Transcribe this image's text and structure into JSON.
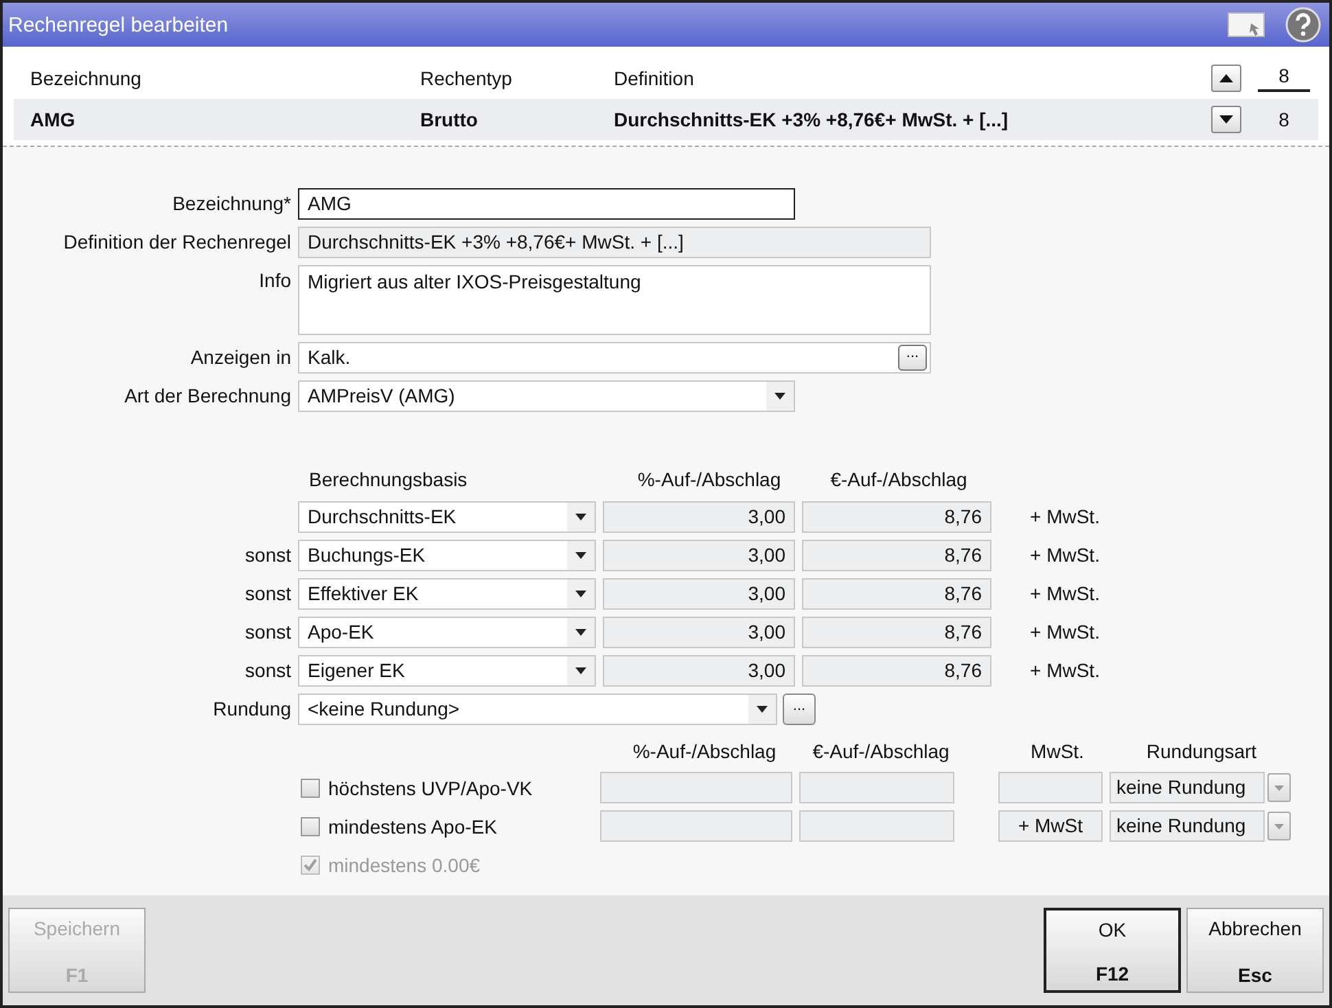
{
  "window": {
    "title": "Rechenregel bearbeiten"
  },
  "table": {
    "columns": [
      "Bezeichnung",
      "Rechentyp",
      "Definition"
    ],
    "rows": [
      {
        "cells": [
          "AMG",
          "Brutto",
          "Durchschnitts-EK +3% +8,76€+ MwSt. + [...]"
        ],
        "selected": true
      }
    ],
    "counts": [
      "8",
      "8"
    ]
  },
  "form": {
    "fields": [
      {
        "label": "Bezeichnung*",
        "value": "AMG",
        "kind": "text"
      },
      {
        "label": "Definition der Rechenregel",
        "value": "Durchschnitts-EK +3% +8,76€+ MwSt. + [...]",
        "kind": "readonly"
      },
      {
        "label": "Info",
        "value": "Migriert aus alter IXOS-Preisgestaltung",
        "kind": "textarea"
      },
      {
        "label": "Anzeigen in",
        "value": "Kalk.",
        "kind": "picker",
        "button": "..."
      },
      {
        "label": "Art der Berechnung",
        "value": "AMPreisV (AMG)",
        "kind": "select"
      }
    ]
  },
  "calc": {
    "headers": [
      "Berechnungsbasis",
      "%-Auf-/Abschlag",
      "€-Auf-/Abschlag"
    ],
    "rows": [
      {
        "basis": "Durchschnitts-EK",
        "percent": "3,00",
        "euro": "8,76",
        "suffix": "+ MwSt."
      },
      {
        "prefix": "sonst",
        "basis": "Buchungs-EK",
        "percent": "3,00",
        "euro": "8,76",
        "suffix": "+ MwSt."
      },
      {
        "prefix": "sonst",
        "basis": "Effektiver EK",
        "percent": "3,00",
        "euro": "8,76",
        "suffix": "+ MwSt."
      },
      {
        "prefix": "sonst",
        "basis": "Apo-EK",
        "percent": "3,00",
        "euro": "8,76",
        "suffix": "+ MwSt."
      },
      {
        "prefix": "sonst",
        "basis": "Eigener EK",
        "percent": "3,00",
        "euro": "8,76",
        "suffix": "+ MwSt."
      }
    ],
    "rounding": {
      "label": "Rundung",
      "value": "<keine Rundung>",
      "button": "..."
    }
  },
  "limits": {
    "headers": [
      "%-Auf-/Abschlag",
      "€-Auf-/Abschlag",
      "MwSt.",
      "Rundungsart"
    ],
    "rows": [
      {
        "kind": "full",
        "label": "höchstens UVP/Apo-VK",
        "checked": false,
        "disabled": false,
        "rounding": "keine Rundung"
      },
      {
        "kind": "full",
        "label": "mindestens Apo-EK",
        "checked": false,
        "disabled": false,
        "mwst": "+ MwSt",
        "rounding": "keine Rundung"
      },
      {
        "kind": "check",
        "label": "mindestens 0.00€",
        "checked": true,
        "disabled": true
      }
    ]
  },
  "footer": {
    "left_buttons": [
      {
        "label": "Speichern",
        "key": "F1",
        "disabled": true,
        "default": false
      }
    ],
    "right_buttons": [
      {
        "label": "OK",
        "key": "F12",
        "disabled": false,
        "default": true
      },
      {
        "label": "Abbrechen",
        "key": "Esc",
        "disabled": false,
        "default": false
      }
    ]
  }
}
